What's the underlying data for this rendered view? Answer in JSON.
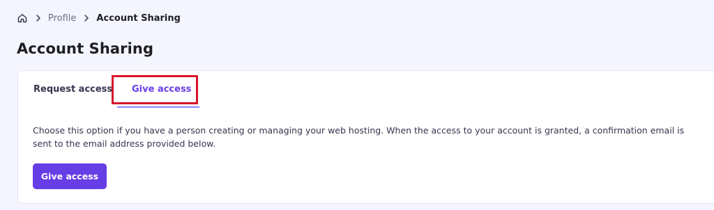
{
  "breadcrumb": {
    "home_icon": "home-icon",
    "separator_icon": "chevron-right-icon",
    "items": [
      "Profile",
      "Account Sharing"
    ]
  },
  "page": {
    "title": "Account Sharing"
  },
  "tabs": {
    "request_label": "Request access",
    "give_label": "Give access",
    "active": "Give access"
  },
  "content": {
    "description": "Choose this option if you have a person creating or managing your web hosting. When the access to your account is granted, a confirmation email is sent to the email address provided below.",
    "button_label": "Give access"
  },
  "colors": {
    "accent": "#673de6",
    "highlight": "#d9132a",
    "background": "#f4f5ff"
  }
}
